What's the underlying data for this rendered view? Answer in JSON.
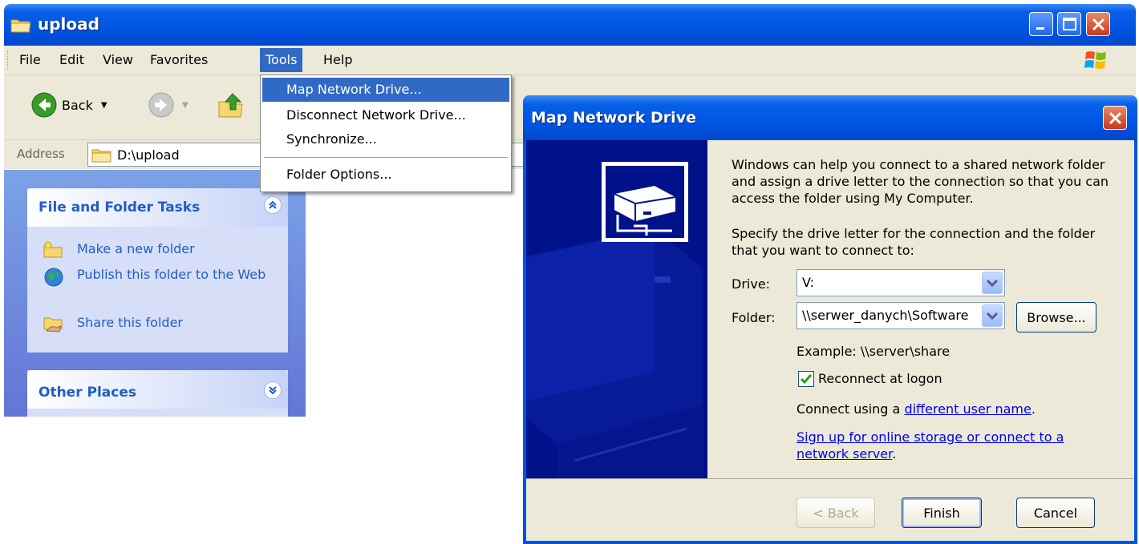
{
  "explorer": {
    "title": "upload",
    "menu": [
      "File",
      "Edit",
      "View",
      "Favorites",
      "Tools",
      "Help"
    ],
    "active_menu": "Tools",
    "toolbar": {
      "back_label": "Back"
    },
    "address": {
      "label": "Address",
      "value": "D:\\upload"
    }
  },
  "tasks_panel": {
    "title": "File and Folder Tasks",
    "items": [
      "Make a new folder",
      "Publish this folder to the Web",
      "Share this folder"
    ]
  },
  "other_places_panel": {
    "title": "Other Places"
  },
  "tools_menu": {
    "items": [
      "Map Network Drive...",
      "Disconnect Network Drive...",
      "Synchronize...",
      "Folder Options..."
    ],
    "highlighted_index": 0
  },
  "dialog": {
    "title": "Map Network Drive",
    "intro": "Windows can help you connect to a shared network folder and assign a drive letter to the connection so that you can access the folder using My Computer.",
    "specify": "Specify the drive letter for the connection and the folder that you want to connect to:",
    "drive_label": "Drive:",
    "drive_value": "V:",
    "folder_label": "Folder:",
    "folder_value": "\\\\serwer_danych\\Software",
    "browse_label": "Browse...",
    "example": "Example: \\\\server\\share",
    "reconnect_label": "Reconnect at logon",
    "reconnect_checked": true,
    "connect_prefix": "Connect using a ",
    "connect_link": "different user name",
    "connect_suffix": ".",
    "signup_link": "Sign up for online storage or connect to a network server",
    "signup_suffix": ".",
    "back_label": "< Back",
    "finish_label": "Finish",
    "cancel_label": "Cancel"
  },
  "colors": {
    "xp_blue": "#0054e3",
    "menu_highlight": "#316ac5",
    "task_text": "#215dc6",
    "dialog_side": "#00128a"
  }
}
